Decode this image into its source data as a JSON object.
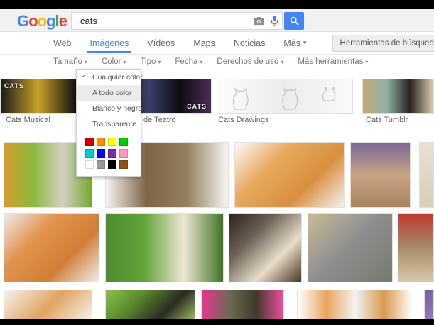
{
  "header": {
    "query": "cats",
    "accent_blue": "#4285f4",
    "logo_letters": [
      {
        "ch": "G",
        "color": "#4285F4"
      },
      {
        "ch": "o",
        "color": "#EA4335"
      },
      {
        "ch": "o",
        "color": "#FBBC05"
      },
      {
        "ch": "g",
        "color": "#4285F4"
      },
      {
        "ch": "l",
        "color": "#34A853"
      },
      {
        "ch": "e",
        "color": "#EA4335"
      }
    ]
  },
  "nav": {
    "arrow_glyph": "▾",
    "tabs": [
      {
        "label": "Web"
      },
      {
        "label": "Imágenes",
        "active": true
      },
      {
        "label": "Vídeos"
      },
      {
        "label": "Maps"
      },
      {
        "label": "Noticias"
      },
      {
        "label": "Más",
        "has_arrow": true
      }
    ],
    "tools_button": "Herramientas de búsqueda"
  },
  "filters": {
    "arrow_glyph": "▾",
    "items": [
      {
        "label": "Tamaño"
      },
      {
        "label": "Color"
      },
      {
        "label": "Tipo"
      },
      {
        "label": "Fecha"
      },
      {
        "label": "Derechos de uso"
      },
      {
        "label": "Más herramientas"
      }
    ]
  },
  "color_menu": {
    "check_glyph": "✓",
    "items": [
      {
        "label": "Cualquier color",
        "checked": true
      },
      {
        "label": "A todo color",
        "highlighted": true
      },
      {
        "label": "Blanco y negro"
      },
      {
        "label": "Transparente"
      }
    ],
    "swatches": [
      "#cc0000",
      "#fb8b00",
      "#ffff00",
      "#00cc00",
      "#00cccc",
      "#0000ff",
      "#762ca7",
      "#ff98bf",
      "#ffffff",
      "#999999",
      "#000000",
      "#885418"
    ]
  },
  "categories": [
    {
      "label": "Cats Musical",
      "overlay": "CATS",
      "alt": "dark collage of Cats musical performers",
      "colors": [
        "#1b1b1b",
        "#c9a227",
        "#121212",
        "#3a2d10"
      ]
    },
    {
      "label": "de Teatro",
      "overlay": "CATS",
      "alt": "dark theater stage scenes",
      "colors": [
        "#16161e",
        "#3a3f66",
        "#0d0d12",
        "#4d2a55"
      ]
    },
    {
      "label": "Cats Drawings",
      "alt": "white background line drawings of cats",
      "colors": [
        "#fdfdfd",
        "#ececec",
        "#fafafa"
      ]
    },
    {
      "label": "Cats Tumblr",
      "alt": "vintage photos of yawning tabby and black cat",
      "colors": [
        "#c8a878",
        "#8fb3a5",
        "#2b2320",
        "#d8cdb2"
      ]
    }
  ],
  "results": {
    "row2": [
      {
        "alt": "screaming cat on green and yellow background",
        "colors": [
          "#d89b2f",
          "#8ab83d",
          "#d3d0c3",
          "#76a832"
        ]
      },
      {
        "alt": "three tabby kittens on white",
        "colors": [
          "#f7f5f2",
          "#7d6548",
          "#94805f",
          "#f7f5f2"
        ]
      },
      {
        "alt": "ginger kitten lying on its back on white",
        "colors": [
          "#fbfbfb",
          "#e8a95e",
          "#d88f3f",
          "#f5f2ee"
        ]
      },
      {
        "alt": "kitten with navy bow tie on tan, purple corner",
        "colors": [
          "#7a6898",
          "#c9a284",
          "#a9845f"
        ]
      },
      {
        "alt": "cropped pale thumbnail",
        "colors": [
          "#e8e0d4",
          "#d9cdb8"
        ]
      }
    ],
    "row3": [
      {
        "alt": "ginger kitten portrait on light background",
        "colors": [
          "#ededeb",
          "#e2944f",
          "#d07f35",
          "#f0eeea"
        ]
      },
      {
        "alt": "siamese cat walking on green grass",
        "colors": [
          "#4e8a2f",
          "#63a53c",
          "#efe6d2",
          "#3f7526"
        ]
      },
      {
        "alt": "fluffy gray and white tuxedo cat on brown",
        "colors": [
          "#2e2218",
          "#6e6258",
          "#e8ddc8",
          "#4a3526"
        ]
      },
      {
        "alt": "gray cat lying on tan blanket",
        "colors": [
          "#c9bb96",
          "#8c8c8c",
          "#777b6e"
        ]
      },
      {
        "alt": "cropped thumbnail red top tan bottom",
        "colors": [
          "#c03a2e",
          "#a88a68",
          "#d8c8a8"
        ]
      }
    ],
    "row4": [
      {
        "alt": "orange cat ears peeking on white",
        "colors": [
          "#f4f4f2",
          "#e0a45f",
          "#f7f7f5"
        ]
      },
      {
        "alt": "dark cat on green background",
        "colors": [
          "#8cc04a",
          "#5a8a2a",
          "#2a2a22",
          "#a8d060"
        ]
      },
      {
        "alt": "tabby cat head against pink blanket",
        "colors": [
          "#e8358f",
          "#6f6a52",
          "#403a2a",
          "#ef4f9f"
        ]
      },
      {
        "alt": "two orange kittens on white",
        "colors": [
          "#ffffff",
          "#e8a55f",
          "#f2f2f0",
          "#d89a50",
          "#ffffff"
        ]
      },
      {
        "alt": "cropped purple thumbnail",
        "colors": [
          "#7a5fa0",
          "#9a7fc0"
        ]
      }
    ]
  }
}
